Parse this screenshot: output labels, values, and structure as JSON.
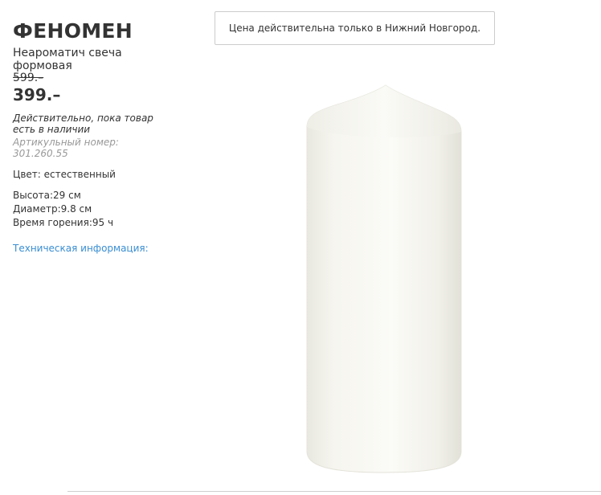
{
  "product": {
    "name": "ФЕНОМЕН",
    "type": "Неароматич свеча формовая",
    "old_price": "599.–",
    "price": "399.–",
    "availability": "Действительно, пока товар есть в наличии",
    "article": "Артикульный номер: 301.260.55",
    "color": "Цвет: естественный",
    "height": "Высота:29 см",
    "diameter": "Диаметр:9.8 см",
    "burn_time": "Время горения:95 ч",
    "tech_info_link": "Техническая информация:"
  },
  "notice": {
    "text": "Цена действительна только в Нижний Новгород."
  },
  "colors": {
    "text": "#333333",
    "muted": "#999999",
    "link": "#3a8ed2",
    "candle": "#f7f6f0"
  },
  "icons": {
    "product_image": "white-pillar-candle"
  }
}
